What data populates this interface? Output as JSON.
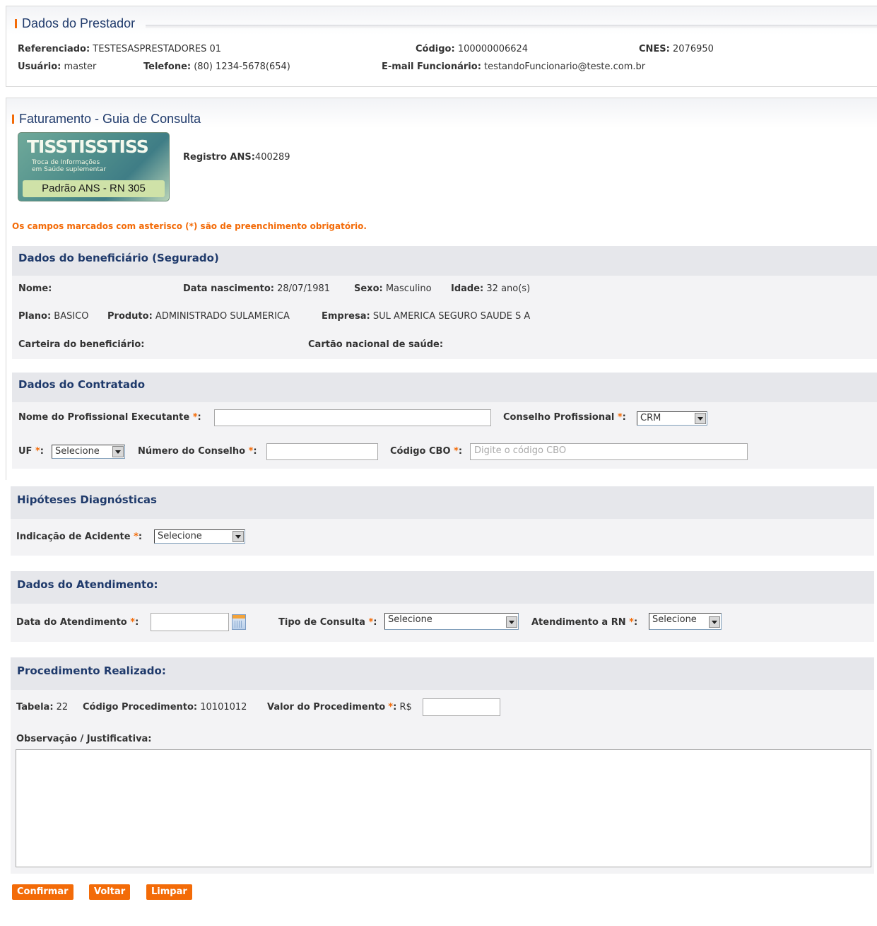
{
  "prestador": {
    "title": "Dados do Prestador",
    "referenciado_label": "Referenciado:",
    "referenciado_value": "TESTESASPRESTADORES 01",
    "codigo_label": "Código:",
    "codigo_value": "100000006624",
    "cnes_label": "CNES:",
    "cnes_value": "2076950",
    "usuario_label": "Usuário:",
    "usuario_value": "master",
    "telefone_label": "Telefone:",
    "telefone_value": "(80) 1234-5678(654)",
    "email_label": "E-mail Funcionário:",
    "email_value": "testandoFuncionario@teste.com.br"
  },
  "faturamento": {
    "title": "Faturamento - Guia de Consulta",
    "logo": {
      "line1": "TISSTISSTISS",
      "line2": "Troca de Informações",
      "line3": "em Saúde suplementar",
      "badge": "Padrão ANS - RN 305"
    },
    "registro_label": "Registro ANS:",
    "registro_value": "400289",
    "required_note": "Os campos marcados com asterisco (*) são de preenchimento obrigatório."
  },
  "beneficiario": {
    "title": "Dados do beneficiário (Segurado)",
    "nome_label": "Nome:",
    "nome_value": "",
    "nascimento_label": "Data nascimento:",
    "nascimento_value": "28/07/1981",
    "sexo_label": "Sexo:",
    "sexo_value": "Masculino",
    "idade_label": "Idade:",
    "idade_value": "32 ano(s)",
    "plano_label": "Plano:",
    "plano_value": "BASICO",
    "produto_label": "Produto:",
    "produto_value": "ADMINISTRADO SULAMERICA",
    "empresa_label": "Empresa:",
    "empresa_value": "SUL AMERICA SEGURO SAUDE S A",
    "carteira_label": "Carteira do beneficiário:",
    "cartao_label": "Cartão nacional de saúde:"
  },
  "contratado": {
    "title": "Dados do Contratado",
    "nome_prof_label": "Nome do Profissional Executante",
    "conselho_label": "Conselho Profissional",
    "conselho_value": "CRM",
    "uf_label": "UF",
    "uf_value": "Selecione",
    "numero_conselho_label": "Número do Conselho",
    "cbo_label": "Código CBO",
    "cbo_placeholder": "Digite o código CBO"
  },
  "hipoteses": {
    "title": "Hipóteses Diagnósticas",
    "acidente_label": "Indicação de Acidente",
    "acidente_value": "Selecione"
  },
  "atendimento": {
    "title": "Dados do Atendimento:",
    "data_label": "Data do Atendimento",
    "tipo_label": "Tipo de Consulta",
    "tipo_value": "Selecione",
    "rn_label": "Atendimento a RN",
    "rn_value": "Selecione"
  },
  "procedimento": {
    "title": "Procedimento Realizado:",
    "tabela_label": "Tabela:",
    "tabela_value": "22",
    "codigo_label": "Código Procedimento:",
    "codigo_value": "10101012",
    "valor_label": "Valor do Procedimento",
    "currency": "R$",
    "obs_label": "Observação / Justificativa:"
  },
  "buttons": {
    "confirmar": "Confirmar",
    "voltar": "Voltar",
    "limpar": "Limpar"
  },
  "common": {
    "asterisk": "*",
    "colon": ":"
  },
  "colors": {
    "accent": "#f36b08",
    "title": "#1f3a6b",
    "section_bg": "#e6e7eb"
  }
}
